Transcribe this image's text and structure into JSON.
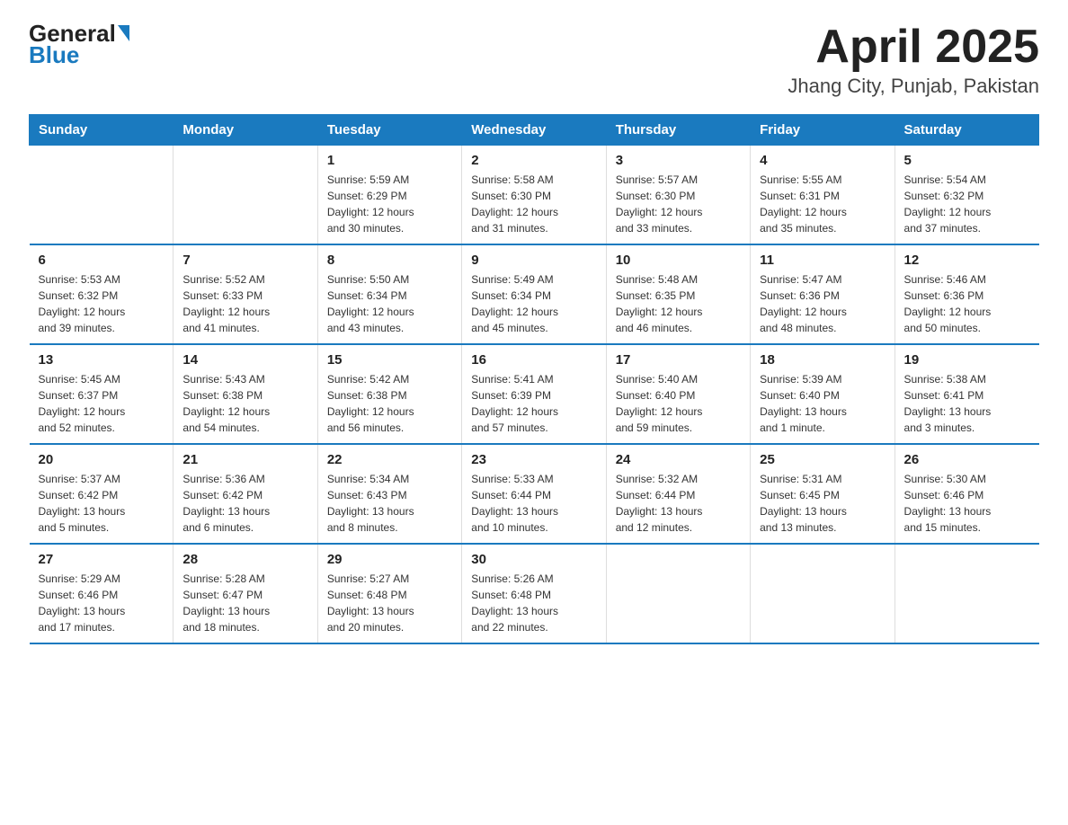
{
  "header": {
    "logo_general": "General",
    "logo_blue": "Blue",
    "month_year": "April 2025",
    "location": "Jhang City, Punjab, Pakistan"
  },
  "days_of_week": [
    "Sunday",
    "Monday",
    "Tuesday",
    "Wednesday",
    "Thursday",
    "Friday",
    "Saturday"
  ],
  "weeks": [
    [
      {
        "day": "",
        "info": ""
      },
      {
        "day": "",
        "info": ""
      },
      {
        "day": "1",
        "info": "Sunrise: 5:59 AM\nSunset: 6:29 PM\nDaylight: 12 hours\nand 30 minutes."
      },
      {
        "day": "2",
        "info": "Sunrise: 5:58 AM\nSunset: 6:30 PM\nDaylight: 12 hours\nand 31 minutes."
      },
      {
        "day": "3",
        "info": "Sunrise: 5:57 AM\nSunset: 6:30 PM\nDaylight: 12 hours\nand 33 minutes."
      },
      {
        "day": "4",
        "info": "Sunrise: 5:55 AM\nSunset: 6:31 PM\nDaylight: 12 hours\nand 35 minutes."
      },
      {
        "day": "5",
        "info": "Sunrise: 5:54 AM\nSunset: 6:32 PM\nDaylight: 12 hours\nand 37 minutes."
      }
    ],
    [
      {
        "day": "6",
        "info": "Sunrise: 5:53 AM\nSunset: 6:32 PM\nDaylight: 12 hours\nand 39 minutes."
      },
      {
        "day": "7",
        "info": "Sunrise: 5:52 AM\nSunset: 6:33 PM\nDaylight: 12 hours\nand 41 minutes."
      },
      {
        "day": "8",
        "info": "Sunrise: 5:50 AM\nSunset: 6:34 PM\nDaylight: 12 hours\nand 43 minutes."
      },
      {
        "day": "9",
        "info": "Sunrise: 5:49 AM\nSunset: 6:34 PM\nDaylight: 12 hours\nand 45 minutes."
      },
      {
        "day": "10",
        "info": "Sunrise: 5:48 AM\nSunset: 6:35 PM\nDaylight: 12 hours\nand 46 minutes."
      },
      {
        "day": "11",
        "info": "Sunrise: 5:47 AM\nSunset: 6:36 PM\nDaylight: 12 hours\nand 48 minutes."
      },
      {
        "day": "12",
        "info": "Sunrise: 5:46 AM\nSunset: 6:36 PM\nDaylight: 12 hours\nand 50 minutes."
      }
    ],
    [
      {
        "day": "13",
        "info": "Sunrise: 5:45 AM\nSunset: 6:37 PM\nDaylight: 12 hours\nand 52 minutes."
      },
      {
        "day": "14",
        "info": "Sunrise: 5:43 AM\nSunset: 6:38 PM\nDaylight: 12 hours\nand 54 minutes."
      },
      {
        "day": "15",
        "info": "Sunrise: 5:42 AM\nSunset: 6:38 PM\nDaylight: 12 hours\nand 56 minutes."
      },
      {
        "day": "16",
        "info": "Sunrise: 5:41 AM\nSunset: 6:39 PM\nDaylight: 12 hours\nand 57 minutes."
      },
      {
        "day": "17",
        "info": "Sunrise: 5:40 AM\nSunset: 6:40 PM\nDaylight: 12 hours\nand 59 minutes."
      },
      {
        "day": "18",
        "info": "Sunrise: 5:39 AM\nSunset: 6:40 PM\nDaylight: 13 hours\nand 1 minute."
      },
      {
        "day": "19",
        "info": "Sunrise: 5:38 AM\nSunset: 6:41 PM\nDaylight: 13 hours\nand 3 minutes."
      }
    ],
    [
      {
        "day": "20",
        "info": "Sunrise: 5:37 AM\nSunset: 6:42 PM\nDaylight: 13 hours\nand 5 minutes."
      },
      {
        "day": "21",
        "info": "Sunrise: 5:36 AM\nSunset: 6:42 PM\nDaylight: 13 hours\nand 6 minutes."
      },
      {
        "day": "22",
        "info": "Sunrise: 5:34 AM\nSunset: 6:43 PM\nDaylight: 13 hours\nand 8 minutes."
      },
      {
        "day": "23",
        "info": "Sunrise: 5:33 AM\nSunset: 6:44 PM\nDaylight: 13 hours\nand 10 minutes."
      },
      {
        "day": "24",
        "info": "Sunrise: 5:32 AM\nSunset: 6:44 PM\nDaylight: 13 hours\nand 12 minutes."
      },
      {
        "day": "25",
        "info": "Sunrise: 5:31 AM\nSunset: 6:45 PM\nDaylight: 13 hours\nand 13 minutes."
      },
      {
        "day": "26",
        "info": "Sunrise: 5:30 AM\nSunset: 6:46 PM\nDaylight: 13 hours\nand 15 minutes."
      }
    ],
    [
      {
        "day": "27",
        "info": "Sunrise: 5:29 AM\nSunset: 6:46 PM\nDaylight: 13 hours\nand 17 minutes."
      },
      {
        "day": "28",
        "info": "Sunrise: 5:28 AM\nSunset: 6:47 PM\nDaylight: 13 hours\nand 18 minutes."
      },
      {
        "day": "29",
        "info": "Sunrise: 5:27 AM\nSunset: 6:48 PM\nDaylight: 13 hours\nand 20 minutes."
      },
      {
        "day": "30",
        "info": "Sunrise: 5:26 AM\nSunset: 6:48 PM\nDaylight: 13 hours\nand 22 minutes."
      },
      {
        "day": "",
        "info": ""
      },
      {
        "day": "",
        "info": ""
      },
      {
        "day": "",
        "info": ""
      }
    ]
  ]
}
